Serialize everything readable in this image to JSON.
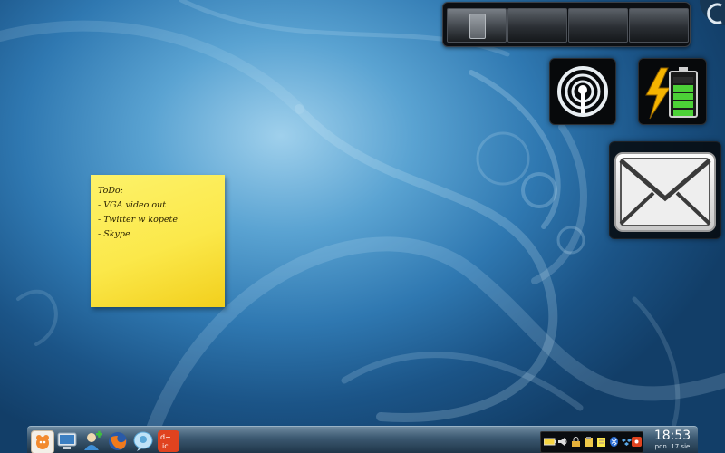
{
  "desktop": {
    "pager": {
      "desktops": 4,
      "active_desktop": 1
    },
    "widgets": {
      "network": {
        "icon": "wifi-signal-icon"
      },
      "battery": {
        "icon": "battery-charging-icon",
        "charge_level": 0.8
      },
      "mail": {
        "icon": "envelope-icon"
      }
    },
    "note": {
      "lines": [
        "ToDo:",
        "- VGA video out",
        "- Twitter w kopete",
        "- Skype"
      ]
    }
  },
  "taskbar": {
    "launchers": [
      {
        "name": "kickoff-launcher",
        "icon": "kde-menu-icon"
      },
      {
        "name": "system-settings-launcher",
        "icon": "monitor-icon"
      },
      {
        "name": "add-user-launcher",
        "icon": "add-user-icon"
      },
      {
        "name": "firefox-launcher",
        "icon": "firefox-icon"
      },
      {
        "name": "kopete-launcher",
        "icon": "chat-bubble-icon"
      },
      {
        "name": "delicious-launcher",
        "icon": "delicious-icon"
      }
    ],
    "tray": [
      {
        "name": "battery-tray-icon"
      },
      {
        "name": "volume-tray-icon"
      },
      {
        "name": "lock-tray-icon"
      },
      {
        "name": "clipboard-tray-icon"
      },
      {
        "name": "notes-tray-icon"
      },
      {
        "name": "bluetooth-tray-icon"
      },
      {
        "name": "dropbox-tray-icon"
      },
      {
        "name": "delicious-tray-icon"
      }
    ],
    "clock": {
      "time": "18:53",
      "date": "pon. 17 sie"
    }
  },
  "colors": {
    "note": "#fbe84a",
    "battery_green": "#4cd137",
    "bolt": "#f5b400",
    "panel": "#3d5a72"
  }
}
